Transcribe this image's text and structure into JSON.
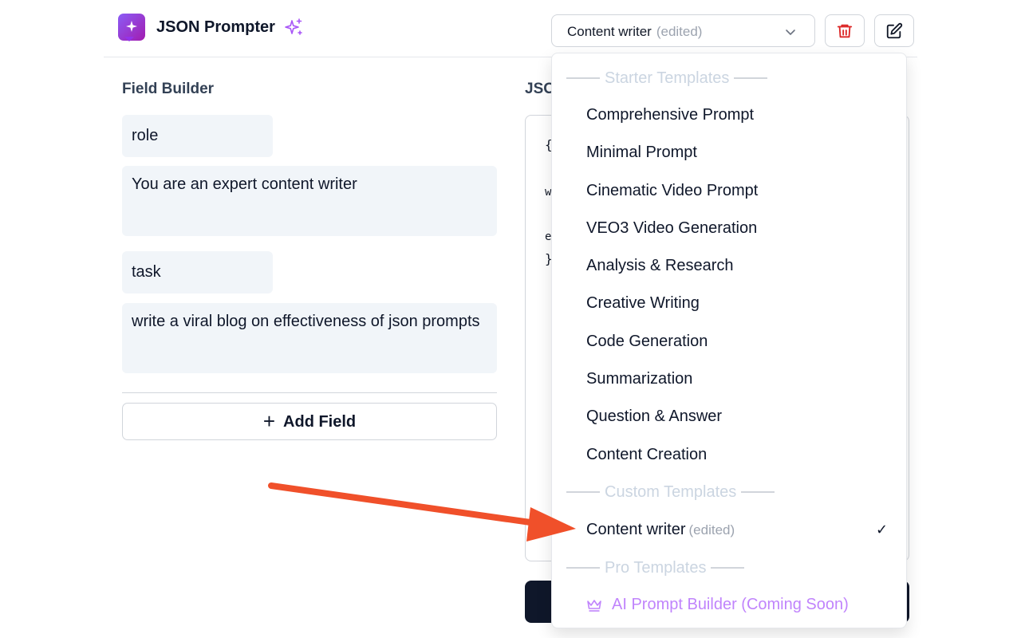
{
  "app": {
    "title": "JSON Prompter"
  },
  "header": {
    "template_select": {
      "label": "Content writer",
      "tag": "(edited)"
    }
  },
  "field_builder": {
    "title": "Field Builder",
    "fields": [
      {
        "key": "role",
        "value": "You are an expert content writer"
      },
      {
        "key": "task",
        "value": "write a viral blog on effectiveness of json prompts"
      }
    ],
    "add_field_label": "Add Field"
  },
  "json_panel": {
    "title_visible": "JSO",
    "code_fragments": [
      "{",
      "w",
      "e",
      "}"
    ]
  },
  "dropdown": {
    "groups": [
      {
        "header": "Starter Templates",
        "options": [
          "Comprehensive Prompt",
          "Minimal Prompt",
          "Cinematic Video Prompt",
          "VEO3 Video Generation",
          "Analysis & Research",
          "Creative Writing",
          "Code Generation",
          "Summarization",
          "Question & Answer",
          "Content Creation"
        ]
      },
      {
        "header": "Custom Templates",
        "options": [
          {
            "label": "Content writer",
            "tag": "(edited)",
            "selected": true
          }
        ]
      },
      {
        "header": "Pro Templates",
        "options": [
          {
            "label": "AI Prompt Builder (Coming Soon)",
            "icon": "crown-icon",
            "disabled": true
          }
        ]
      }
    ],
    "check_mark": "✓"
  },
  "colors": {
    "brand_gradient_start": "#8b5cf6",
    "brand_gradient_end": "#a21caf",
    "pro_text": "#c084fc",
    "delete_icon": "#dc2626",
    "annotation_arrow": "#f0502a",
    "dark_button": "#0f172a"
  }
}
